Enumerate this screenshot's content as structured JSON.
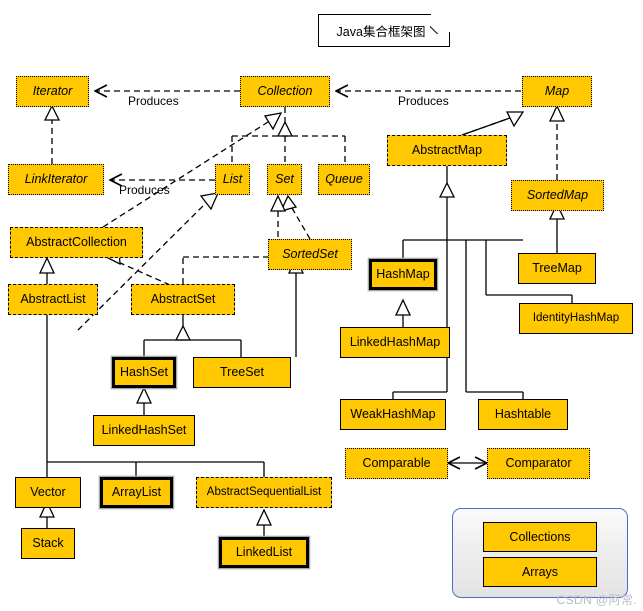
{
  "diagram": {
    "title": "Java集合框架图",
    "watermark": "CSDN @阿常."
  },
  "colors": {
    "node_fill": "#FFC800",
    "node_stroke": "#000000",
    "panel_border": "#4a6fbf",
    "watermark": "#b9bcc4"
  },
  "edge_labels": {
    "produces_collection_iterator": "Produces",
    "produces_list_linkiterator": "Produces",
    "produces_map_collection": "Produces"
  },
  "nodes": {
    "iterator": "Iterator",
    "collection": "Collection",
    "map": "Map",
    "linkiterator": "LinkIterator",
    "list": "List",
    "set": "Set",
    "queue": "Queue",
    "abstractmap": "AbstractMap",
    "sortedmap": "SortedMap",
    "abstractcollection": "AbstractCollection",
    "sortedset": "SortedSet",
    "hashmap": "HashMap",
    "treemap": "TreeMap",
    "abstractlist": "AbstractList",
    "abstractset": "AbstractSet",
    "identityhashmap": "IdentityHashMap",
    "linkedhashmap": "LinkedHashMap",
    "hashset": "HashSet",
    "treeset": "TreeSet",
    "linkedhashset": "LinkedHashSet",
    "weakhashmap": "WeakHashMap",
    "hashtable": "Hashtable",
    "comparable": "Comparable",
    "comparator": "Comparator",
    "vector": "Vector",
    "arraylist": "ArrayList",
    "abstractsequentiallist": "AbstractSequentialList",
    "stack": "Stack",
    "linkedlist": "LinkedList",
    "collections": "Collections",
    "arrays": "Arrays"
  }
}
